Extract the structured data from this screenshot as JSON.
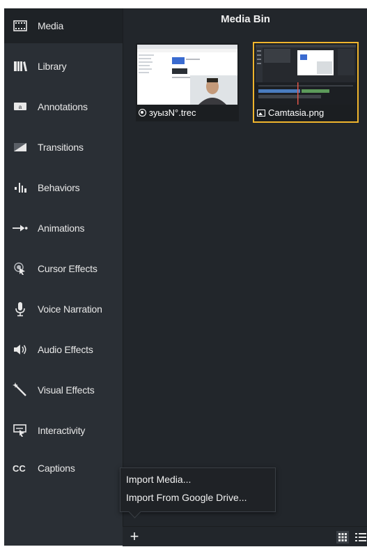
{
  "colors": {
    "accent": "#f0b52d",
    "sidebar_bg": "#2a2f35",
    "main_bg": "#22262b"
  },
  "sidebar": {
    "items": [
      {
        "label": "Media",
        "icon": "film-icon",
        "active": true
      },
      {
        "label": "Library",
        "icon": "library-icon"
      },
      {
        "label": "Annotations",
        "icon": "annotation-icon"
      },
      {
        "label": "Transitions",
        "icon": "transition-icon"
      },
      {
        "label": "Behaviors",
        "icon": "behaviors-icon"
      },
      {
        "label": "Animations",
        "icon": "animation-arrow-icon"
      },
      {
        "label": "Cursor Effects",
        "icon": "cursor-icon"
      },
      {
        "label": "Voice Narration",
        "icon": "microphone-icon"
      },
      {
        "label": "Audio Effects",
        "icon": "speaker-icon"
      },
      {
        "label": "Visual Effects",
        "icon": "magic-wand-icon"
      },
      {
        "label": "Interactivity",
        "icon": "interactivity-icon"
      },
      {
        "label": "Captions",
        "icon": "cc-icon"
      }
    ]
  },
  "main": {
    "title": "Media Bin",
    "media": [
      {
        "name": "зуызN°.trec",
        "type": "recording",
        "icon": "record-icon",
        "selected": false
      },
      {
        "name": "Camtasia.png",
        "type": "image",
        "icon": "image-icon",
        "selected": true
      }
    ]
  },
  "import_menu": {
    "items": [
      "Import Media...",
      "Import From Google Drive..."
    ]
  },
  "bottom": {
    "add_label": "+",
    "view_grid": "grid-view-icon",
    "view_list": "list-view-icon"
  }
}
